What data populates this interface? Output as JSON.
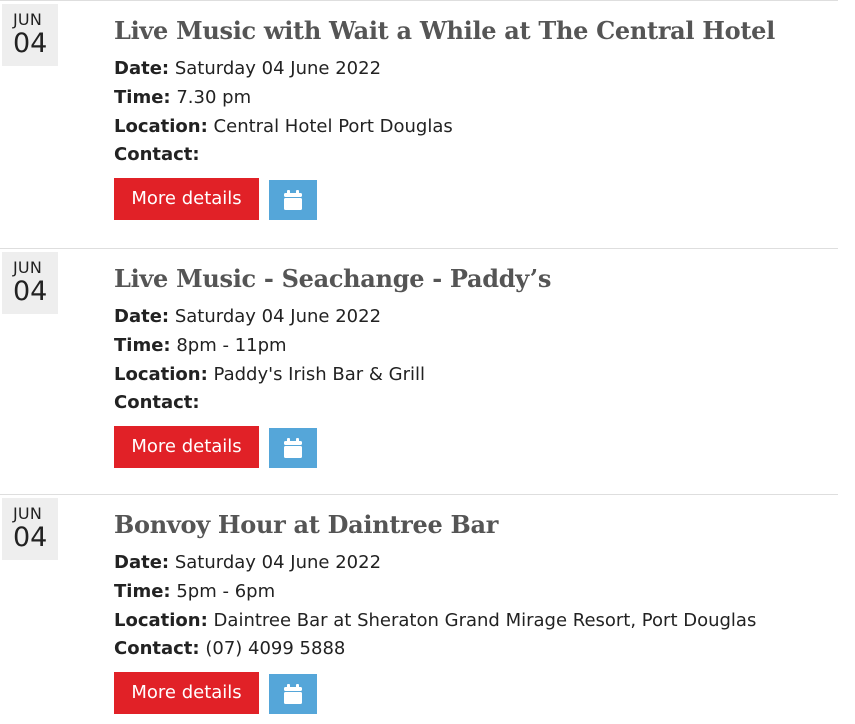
{
  "events": [
    {
      "month": "JUN",
      "day": "04",
      "title": "Live Music with Wait a While at The Central Hotel",
      "date_label": "Date:",
      "date": "Saturday 04 June 2022",
      "time_label": "Time:",
      "time": "7.30 pm",
      "location_label": "Location:",
      "location": "Central Hotel Port Douglas",
      "contact_label": "Contact:",
      "contact": "",
      "more_label": "More details",
      "calendar_icon": "calendar-icon"
    },
    {
      "month": "JUN",
      "day": "04",
      "title": "Live Music - Seachange - Paddy’s",
      "date_label": "Date:",
      "date": "Saturday 04 June 2022",
      "time_label": "Time:",
      "time": "8pm - 11pm",
      "location_label": "Location:",
      "location": "Paddy's Irish Bar & Grill",
      "contact_label": "Contact:",
      "contact": "",
      "more_label": "More details",
      "calendar_icon": "calendar-icon"
    },
    {
      "month": "JUN",
      "day": "04",
      "title": "Bonvoy Hour at Daintree Bar",
      "date_label": "Date:",
      "date": "Saturday 04 June 2022",
      "time_label": "Time:",
      "time": "5pm - 6pm",
      "location_label": "Location:",
      "location": "Daintree Bar at Sheraton Grand Mirage Resort, Port Douglas",
      "contact_label": "Contact:",
      "contact": "(07) 4099 5888",
      "more_label": "More details",
      "calendar_icon": "calendar-icon"
    }
  ],
  "colors": {
    "more_button": "#e12127",
    "calendar_button": "#55a6d9",
    "date_box": "#eeeeee",
    "title": "#555555",
    "divider": "#dedede"
  }
}
